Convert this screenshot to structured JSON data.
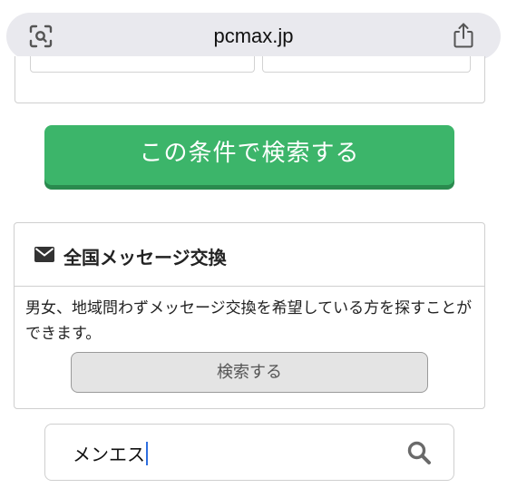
{
  "browser": {
    "url": "pcmax.jp",
    "icons": [
      "lens-icon",
      "share-icon"
    ]
  },
  "search_conditions_button": {
    "label": "この条件で検索する",
    "color": "#3cb56a"
  },
  "message_exchange": {
    "icon": "envelope-icon",
    "title": "全国メッセージ交換",
    "description": "男女、地域問わずメッセージ交換を希望している方を探すことができます。",
    "button_label": "検索する"
  },
  "keyword_search": {
    "value": "メンエス",
    "icon": "search-icon"
  }
}
